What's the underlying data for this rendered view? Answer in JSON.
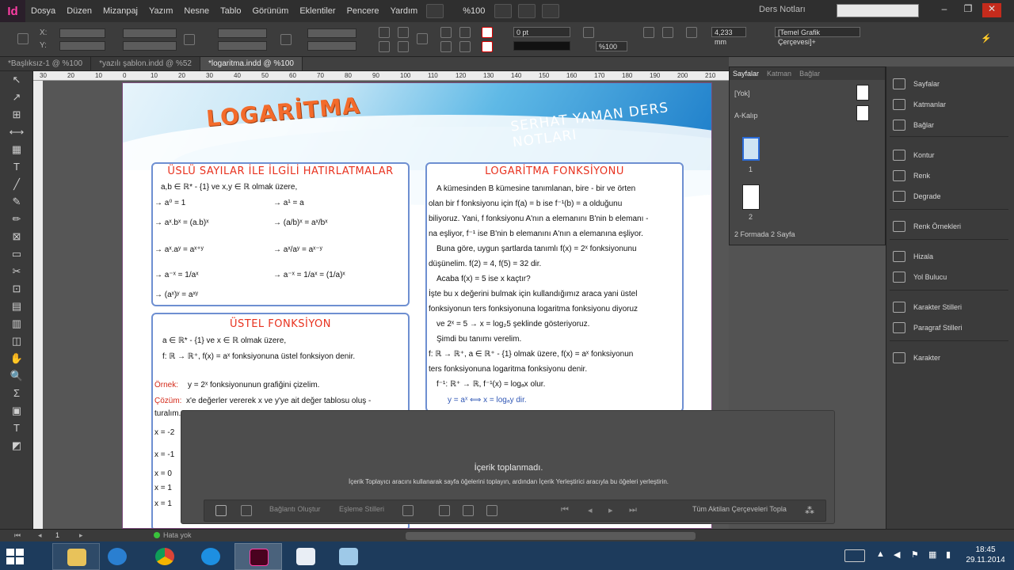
{
  "app": {
    "logo": "Id",
    "menu": [
      "Dosya",
      "Düzen",
      "Mizanpaj",
      "Yazım",
      "Nesne",
      "Tablo",
      "Görünüm",
      "Eklentiler",
      "Pencere",
      "Yardım"
    ],
    "zoom": "%100",
    "workspace": "Ders Notları",
    "search_placeholder": "",
    "win_controls": [
      "–",
      "❐",
      "✕"
    ]
  },
  "control_panel": {
    "x_label": "X:",
    "y_label": "Y:",
    "stroke_weight": "0 pt",
    "opacity": "%100",
    "dimension": "4,233 mm",
    "frame_style": "[Temel Grafik Çerçevesi]+"
  },
  "tabs": [
    {
      "label": "*Başlıksız-1 @ %100",
      "active": false
    },
    {
      "label": "*yazılı şablon.indd @ %52",
      "active": false
    },
    {
      "label": "*logaritma.indd @ %100",
      "active": true
    }
  ],
  "ruler_ticks": [
    "30",
    "20",
    "10",
    "0",
    "10",
    "20",
    "30",
    "40",
    "50",
    "60",
    "70",
    "80",
    "90",
    "100",
    "110",
    "120",
    "130",
    "140",
    "150",
    "160",
    "170",
    "180",
    "190",
    "200",
    "210"
  ],
  "tools": [
    "↖",
    "↗",
    "⊞",
    "⟷",
    "▦",
    "T",
    "╱",
    "✎",
    "✏",
    "⊠",
    "▭",
    "✂",
    "⊡",
    "▤",
    "▥",
    "◫",
    "✋",
    "🔍",
    "Σ",
    "▣",
    "T",
    "◩"
  ],
  "document": {
    "banner_title": "LOGARİTMA",
    "banner_sub": "SERHAT YAMAN DERS NOTLARI",
    "box1_title": "ÜSLÜ SAYILAR İLE İLGİLİ HATIRLATMALAR",
    "box1_lines": [
      "a,b ∈ ℝ* - {1}  ve  x,y ∈ ℝ  olmak üzere,",
      "→ a⁰ = 1",
      "→ a¹ = a",
      "→ aˣ.bˣ = (a.b)ˣ",
      "→ (a/b)ˣ = aˣ/bˣ",
      "→ aˣ.aʸ = aˣ⁺ʸ",
      "→ aˣ/aʸ = aˣ⁻ʸ",
      "→ a⁻ˣ = 1/aˣ",
      "→ a⁻ˣ = 1/aˣ = (1/a)ˣ",
      "→ (aˣ)ʸ = aˣʸ"
    ],
    "box2_title": "ÜSTEL FONKSİYON",
    "box2_lines": [
      "a ∈ ℝ* - {1}  ve  x ∈ ℝ  olmak üzere,",
      "f: ℝ → ℝ⁺, f(x) = aˣ fonksiyonuna üstel fonksiyon denir."
    ],
    "box2_example_label": "Örnek:",
    "box2_example": "y = 2ˣ fonksiyonunun grafiğini çizelim.",
    "box2_solution_label": "Çözüm:",
    "box2_solution": "x'e değerler vererek x ve y'ye ait değer tablosu oluş -",
    "box2_cont": "turalım.",
    "box2_rows": [
      "x = -2",
      "x = -1",
      "x = 0",
      "x = 1",
      "x = 1"
    ],
    "box3_title": "LOGARİTMA FONKSİYONU",
    "box3_lines": [
      "A kümesinden B kümesine tanımlanan, bire - bir ve örten",
      "olan bir f fonksiyonu için f(a) = b  ise  f⁻¹(b) = a olduğunu",
      "biliyoruz. Yani, f fonksiyonu A'nın a elemanını B'nin b elemanı -",
      "na eşliyor, f⁻¹ ise B'nin b elemanını A'nın a elemanına eşliyor.",
      "Buna göre, uygun şartlarda tanımlı  f(x) = 2ˣ  fonksiyonunu",
      "düşünelim. f(2) = 4, f(5) = 32  dir.",
      "Acaba f(x) = 5  ise x kaçtır?",
      "İşte bu x değerini bulmak için kullandığımız araca yani üstel",
      "fonksiyonun ters fonksiyonuna logaritma fonksiyonu diyoruz",
      "ve  2ˣ = 5 → x = log₂5  şeklinde gösteriyoruz.",
      "Şimdi bu tanımı verelim.",
      "f: ℝ → ℝ⁺, a ∈ ℝ⁺ - {1} olmak üzere, f(x) = aˣ  fonksiyonun",
      "ters fonksiyonuna logaritma fonksiyonu denir.",
      "f⁻¹: ℝ⁺ → ℝ, f⁻¹(x) = logₐx   olur.",
      "y = aˣ ⟺ x = logₐy     dir."
    ]
  },
  "pages_panel": {
    "tabs": [
      "Sayfalar",
      "Katman",
      "Bağlar"
    ],
    "none_label": "[Yok]",
    "master_label": "A-Kalıp",
    "page_numbers": [
      "1",
      "2"
    ],
    "footer": "2 Formada 2 Sayfa"
  },
  "right_dock": [
    {
      "label": "Sayfalar",
      "icon": "pages-icon"
    },
    {
      "label": "Katmanlar",
      "icon": "layers-icon"
    },
    {
      "label": "Bağlar",
      "icon": "links-icon"
    },
    {
      "label": "Kontur",
      "icon": "stroke-icon"
    },
    {
      "label": "Renk",
      "icon": "color-icon"
    },
    {
      "label": "Degrade",
      "icon": "gradient-icon"
    },
    {
      "label": "Renk Örnekleri",
      "icon": "swatches-icon"
    },
    {
      "label": "Hizala",
      "icon": "align-icon"
    },
    {
      "label": "Yol Bulucu",
      "icon": "pathfinder-icon"
    },
    {
      "label": "Karakter Stilleri",
      "icon": "character-styles-icon"
    },
    {
      "label": "Paragraf Stilleri",
      "icon": "paragraph-styles-icon"
    },
    {
      "label": "Karakter",
      "icon": "character-icon"
    }
  ],
  "content_collector": {
    "title": "İçerik toplanmadı.",
    "message": "İçerik Toplayıcı aracını kullanarak sayfa öğelerini toplayın, ardından İçerik Yerleştirici aracıyla bu öğeleri yerleştirin.",
    "link_label": "Bağlantı Oluştur",
    "map_label": "Eşleme Stilleri",
    "all_frames_label": "Tüm Aktilan Çerçeveleri Topla"
  },
  "status_bar": {
    "page": "1",
    "errors": "Hata yok"
  },
  "taskbar": {
    "time": "18:45",
    "date": "29.11.2014"
  }
}
